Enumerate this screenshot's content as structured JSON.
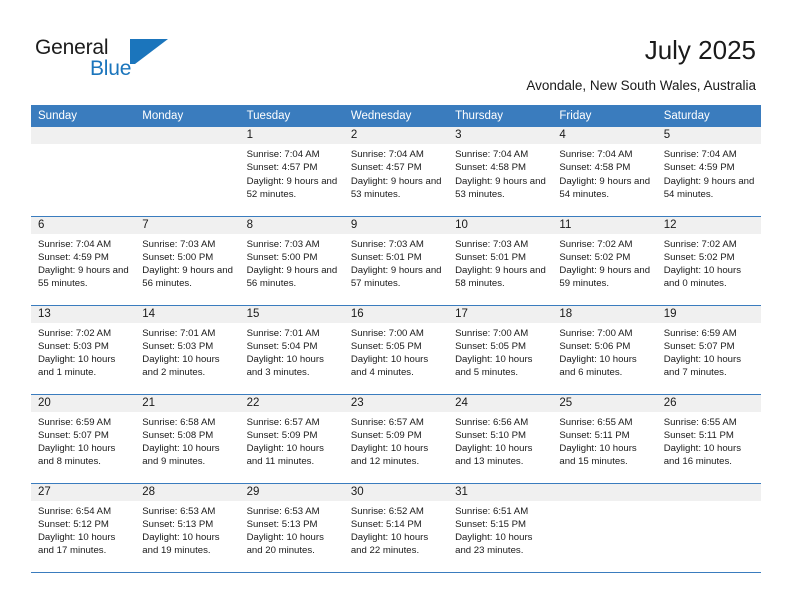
{
  "brand": {
    "name_part1": "General",
    "name_part2": "Blue",
    "accent_color": "#1b75bc"
  },
  "header": {
    "title": "July 2025",
    "subtitle": "Avondale, New South Wales, Australia"
  },
  "calendar": {
    "header_bg": "#3a7cbe",
    "daynum_bg": "#f0f0f0",
    "weekdays": [
      "Sunday",
      "Monday",
      "Tuesday",
      "Wednesday",
      "Thursday",
      "Friday",
      "Saturday"
    ],
    "weeks": [
      [
        {
          "day": "",
          "blank": true
        },
        {
          "day": "",
          "blank": true
        },
        {
          "day": "1",
          "sunrise": "Sunrise: 7:04 AM",
          "sunset": "Sunset: 4:57 PM",
          "daylight": "Daylight: 9 hours and 52 minutes."
        },
        {
          "day": "2",
          "sunrise": "Sunrise: 7:04 AM",
          "sunset": "Sunset: 4:57 PM",
          "daylight": "Daylight: 9 hours and 53 minutes."
        },
        {
          "day": "3",
          "sunrise": "Sunrise: 7:04 AM",
          "sunset": "Sunset: 4:58 PM",
          "daylight": "Daylight: 9 hours and 53 minutes."
        },
        {
          "day": "4",
          "sunrise": "Sunrise: 7:04 AM",
          "sunset": "Sunset: 4:58 PM",
          "daylight": "Daylight: 9 hours and 54 minutes."
        },
        {
          "day": "5",
          "sunrise": "Sunrise: 7:04 AM",
          "sunset": "Sunset: 4:59 PM",
          "daylight": "Daylight: 9 hours and 54 minutes."
        }
      ],
      [
        {
          "day": "6",
          "sunrise": "Sunrise: 7:04 AM",
          "sunset": "Sunset: 4:59 PM",
          "daylight": "Daylight: 9 hours and 55 minutes."
        },
        {
          "day": "7",
          "sunrise": "Sunrise: 7:03 AM",
          "sunset": "Sunset: 5:00 PM",
          "daylight": "Daylight: 9 hours and 56 minutes."
        },
        {
          "day": "8",
          "sunrise": "Sunrise: 7:03 AM",
          "sunset": "Sunset: 5:00 PM",
          "daylight": "Daylight: 9 hours and 56 minutes."
        },
        {
          "day": "9",
          "sunrise": "Sunrise: 7:03 AM",
          "sunset": "Sunset: 5:01 PM",
          "daylight": "Daylight: 9 hours and 57 minutes."
        },
        {
          "day": "10",
          "sunrise": "Sunrise: 7:03 AM",
          "sunset": "Sunset: 5:01 PM",
          "daylight": "Daylight: 9 hours and 58 minutes."
        },
        {
          "day": "11",
          "sunrise": "Sunrise: 7:02 AM",
          "sunset": "Sunset: 5:02 PM",
          "daylight": "Daylight: 9 hours and 59 minutes."
        },
        {
          "day": "12",
          "sunrise": "Sunrise: 7:02 AM",
          "sunset": "Sunset: 5:02 PM",
          "daylight": "Daylight: 10 hours and 0 minutes."
        }
      ],
      [
        {
          "day": "13",
          "sunrise": "Sunrise: 7:02 AM",
          "sunset": "Sunset: 5:03 PM",
          "daylight": "Daylight: 10 hours and 1 minute."
        },
        {
          "day": "14",
          "sunrise": "Sunrise: 7:01 AM",
          "sunset": "Sunset: 5:03 PM",
          "daylight": "Daylight: 10 hours and 2 minutes."
        },
        {
          "day": "15",
          "sunrise": "Sunrise: 7:01 AM",
          "sunset": "Sunset: 5:04 PM",
          "daylight": "Daylight: 10 hours and 3 minutes."
        },
        {
          "day": "16",
          "sunrise": "Sunrise: 7:00 AM",
          "sunset": "Sunset: 5:05 PM",
          "daylight": "Daylight: 10 hours and 4 minutes."
        },
        {
          "day": "17",
          "sunrise": "Sunrise: 7:00 AM",
          "sunset": "Sunset: 5:05 PM",
          "daylight": "Daylight: 10 hours and 5 minutes."
        },
        {
          "day": "18",
          "sunrise": "Sunrise: 7:00 AM",
          "sunset": "Sunset: 5:06 PM",
          "daylight": "Daylight: 10 hours and 6 minutes."
        },
        {
          "day": "19",
          "sunrise": "Sunrise: 6:59 AM",
          "sunset": "Sunset: 5:07 PM",
          "daylight": "Daylight: 10 hours and 7 minutes."
        }
      ],
      [
        {
          "day": "20",
          "sunrise": "Sunrise: 6:59 AM",
          "sunset": "Sunset: 5:07 PM",
          "daylight": "Daylight: 10 hours and 8 minutes."
        },
        {
          "day": "21",
          "sunrise": "Sunrise: 6:58 AM",
          "sunset": "Sunset: 5:08 PM",
          "daylight": "Daylight: 10 hours and 9 minutes."
        },
        {
          "day": "22",
          "sunrise": "Sunrise: 6:57 AM",
          "sunset": "Sunset: 5:09 PM",
          "daylight": "Daylight: 10 hours and 11 minutes."
        },
        {
          "day": "23",
          "sunrise": "Sunrise: 6:57 AM",
          "sunset": "Sunset: 5:09 PM",
          "daylight": "Daylight: 10 hours and 12 minutes."
        },
        {
          "day": "24",
          "sunrise": "Sunrise: 6:56 AM",
          "sunset": "Sunset: 5:10 PM",
          "daylight": "Daylight: 10 hours and 13 minutes."
        },
        {
          "day": "25",
          "sunrise": "Sunrise: 6:55 AM",
          "sunset": "Sunset: 5:11 PM",
          "daylight": "Daylight: 10 hours and 15 minutes."
        },
        {
          "day": "26",
          "sunrise": "Sunrise: 6:55 AM",
          "sunset": "Sunset: 5:11 PM",
          "daylight": "Daylight: 10 hours and 16 minutes."
        }
      ],
      [
        {
          "day": "27",
          "sunrise": "Sunrise: 6:54 AM",
          "sunset": "Sunset: 5:12 PM",
          "daylight": "Daylight: 10 hours and 17 minutes."
        },
        {
          "day": "28",
          "sunrise": "Sunrise: 6:53 AM",
          "sunset": "Sunset: 5:13 PM",
          "daylight": "Daylight: 10 hours and 19 minutes."
        },
        {
          "day": "29",
          "sunrise": "Sunrise: 6:53 AM",
          "sunset": "Sunset: 5:13 PM",
          "daylight": "Daylight: 10 hours and 20 minutes."
        },
        {
          "day": "30",
          "sunrise": "Sunrise: 6:52 AM",
          "sunset": "Sunset: 5:14 PM",
          "daylight": "Daylight: 10 hours and 22 minutes."
        },
        {
          "day": "31",
          "sunrise": "Sunrise: 6:51 AM",
          "sunset": "Sunset: 5:15 PM",
          "daylight": "Daylight: 10 hours and 23 minutes."
        },
        {
          "day": "",
          "blank": true
        },
        {
          "day": "",
          "blank": true
        }
      ]
    ]
  }
}
